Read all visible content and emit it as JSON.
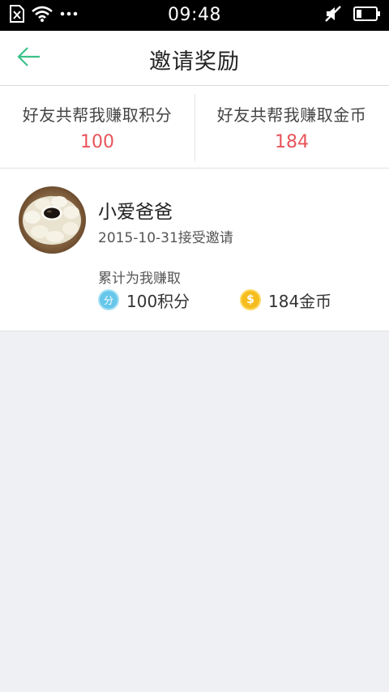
{
  "status_bar": {
    "time": "09:48"
  },
  "header": {
    "title": "邀请奖励"
  },
  "summary": {
    "points": {
      "label": "好友共帮我赚取积分",
      "value": "100"
    },
    "coins": {
      "label": "好友共帮我赚取金币",
      "value": "184"
    }
  },
  "friend": {
    "name": "小爱爸爸",
    "accepted": "2015-10-31接受邀请",
    "earned_label": "累计为我赚取",
    "points_badge": "分",
    "points_text": "100积分",
    "coin_badge": "$",
    "coins_text": "184金币"
  },
  "colors": {
    "accent": "#3cc28a",
    "value_red": "#e8545a",
    "points_blue": "#66c7ea",
    "coin_gold": "#f5bd1d"
  },
  "icons": {
    "back": "arrow-left-icon",
    "sim": "no-sim-icon",
    "wifi": "wifi-icon",
    "more": "more-dots-icon",
    "mute": "mute-icon",
    "battery": "battery-icon"
  }
}
